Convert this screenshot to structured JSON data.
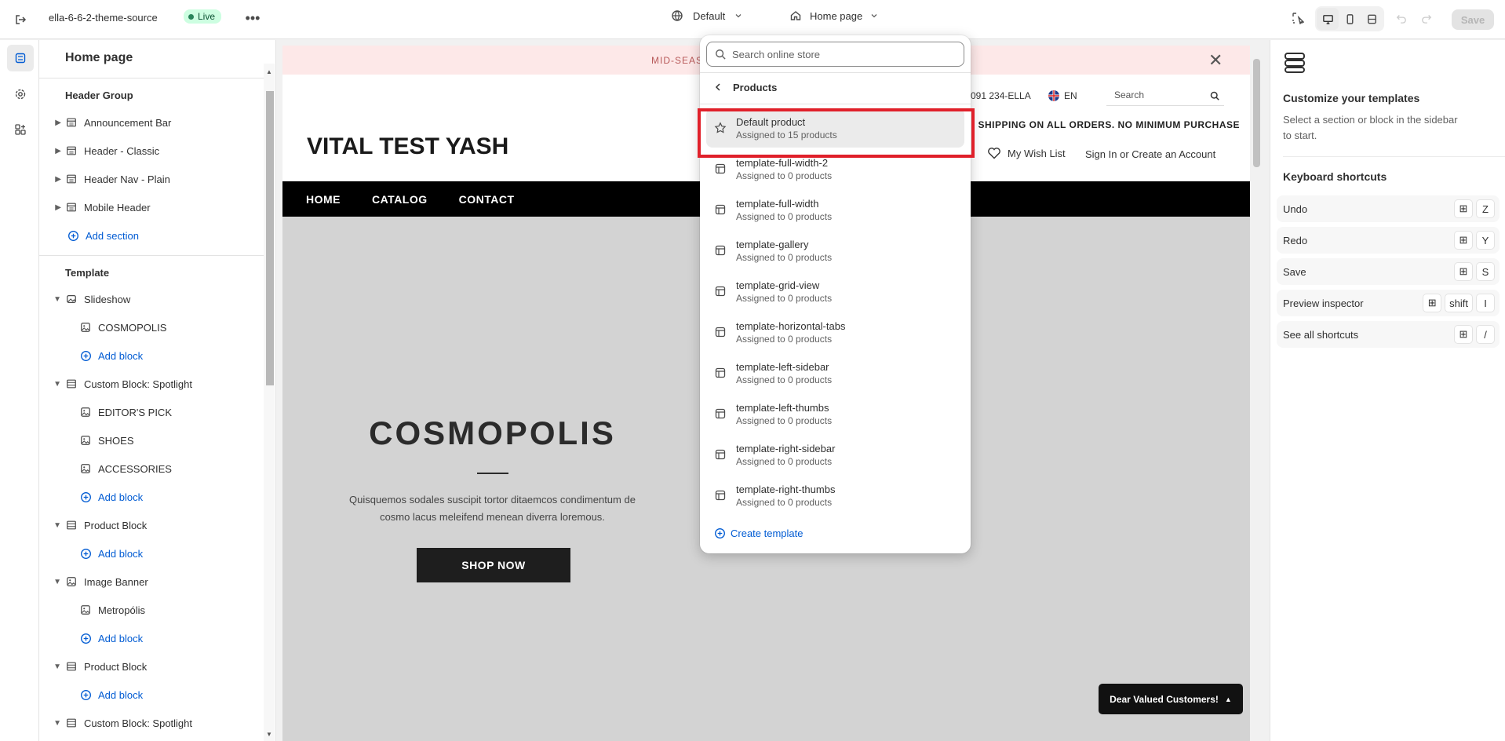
{
  "topbar": {
    "theme_name": "ella-6-6-2-theme-source",
    "live_label": "Live",
    "context_label": "Default",
    "page_label": "Home page",
    "save_label": "Save"
  },
  "sidebar": {
    "title": "Home page",
    "header_group_label": "Header Group",
    "header_items": [
      {
        "label": "Announcement Bar"
      },
      {
        "label": "Header - Classic"
      },
      {
        "label": "Header Nav - Plain"
      },
      {
        "label": "Mobile Header"
      }
    ],
    "add_section_label": "Add section",
    "template_label": "Template",
    "template_rows": [
      {
        "label": "Slideshow"
      },
      {
        "label": "COSMOPOLIS"
      },
      {
        "label": "Add block"
      },
      {
        "label": "Custom Block: Spotlight"
      },
      {
        "label": "EDITOR'S PICK"
      },
      {
        "label": "SHOES"
      },
      {
        "label": "ACCESSORIES"
      },
      {
        "label": "Add block"
      },
      {
        "label": "Product Block"
      },
      {
        "label": "Add block"
      },
      {
        "label": "Image Banner"
      },
      {
        "label": "Metropólis"
      },
      {
        "label": "Add block"
      },
      {
        "label": "Product Block"
      },
      {
        "label": "Add block"
      },
      {
        "label": "Custom Block: Spotlight"
      }
    ]
  },
  "preview": {
    "announcement_text": "MID-SEAS",
    "phone_text": "091 234-ELLA",
    "language": "EN",
    "search_placeholder": "Search",
    "shipping_text": "SHIPPING ON ALL ORDERS. NO MINIMUM PURCHASE",
    "store_name": "VITAL TEST YASH",
    "wishlist_label": "My Wish List",
    "account_label": "Sign In or Create an Account",
    "nav": [
      "HOME",
      "CATALOG",
      "CONTACT"
    ],
    "hero_title": "COSMOPOLIS",
    "hero_text_1": "Quisquemos sodales suscipit tortor ditaemcos condimentum de",
    "hero_text_2": "cosmo lacus meleifend menean diverra loremous.",
    "hero_button": "SHOP NOW",
    "popup_label": "Dear Valued Customers!"
  },
  "dropdown": {
    "search_placeholder": "Search online store",
    "back_label": "Products",
    "items": [
      {
        "name": "Default product",
        "sub": "Assigned to 15 products"
      },
      {
        "name": "template-full-width-2",
        "sub": "Assigned to 0 products"
      },
      {
        "name": "template-full-width",
        "sub": "Assigned to 0 products"
      },
      {
        "name": "template-gallery",
        "sub": "Assigned to 0 products"
      },
      {
        "name": "template-grid-view",
        "sub": "Assigned to 0 products"
      },
      {
        "name": "template-horizontal-tabs",
        "sub": "Assigned to 0 products"
      },
      {
        "name": "template-left-sidebar",
        "sub": "Assigned to 0 products"
      },
      {
        "name": "template-left-thumbs",
        "sub": "Assigned to 0 products"
      },
      {
        "name": "template-right-sidebar",
        "sub": "Assigned to 0 products"
      },
      {
        "name": "template-right-thumbs",
        "sub": "Assigned to 0 products"
      }
    ],
    "create_label": "Create template"
  },
  "right_panel": {
    "title": "Customize your templates",
    "desc": "Select a section or block in the sidebar to start.",
    "shortcuts_title": "Keyboard shortcuts",
    "shortcuts": [
      {
        "label": "Undo",
        "keys": [
          "⊞",
          "Z"
        ]
      },
      {
        "label": "Redo",
        "keys": [
          "⊞",
          "Y"
        ]
      },
      {
        "label": "Save",
        "keys": [
          "⊞",
          "S"
        ]
      },
      {
        "label": "Preview inspector",
        "keys": [
          "⊞",
          "shift",
          "I"
        ]
      },
      {
        "label": "See all shortcuts",
        "keys": [
          "⊞",
          "/"
        ]
      }
    ]
  },
  "colors": {
    "accent_link": "#005bd3",
    "highlight_box": "#e0202a",
    "live_badge_bg": "#cdfee1",
    "announcement_bg": "#fde8e8",
    "hero_bg": "#d3d3d3"
  }
}
